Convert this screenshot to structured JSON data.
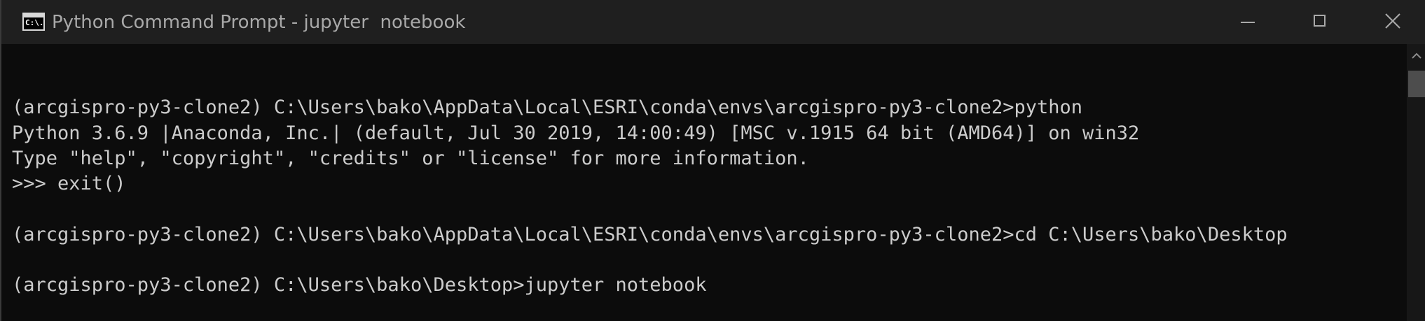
{
  "window": {
    "title": "Python Command Prompt - jupyter  notebook",
    "app_icon_text": "C:\\."
  },
  "console": {
    "lines": [
      "",
      "(arcgispro-py3-clone2) C:\\Users\\bako\\AppData\\Local\\ESRI\\conda\\envs\\arcgispro-py3-clone2>python",
      "Python 3.6.9 |Anaconda, Inc.| (default, Jul 30 2019, 14:00:49) [MSC v.1915 64 bit (AMD64)] on win32",
      "Type \"help\", \"copyright\", \"credits\" or \"license\" for more information.",
      ">>> exit()",
      "",
      "(arcgispro-py3-clone2) C:\\Users\\bako\\AppData\\Local\\ESRI\\conda\\envs\\arcgispro-py3-clone2>cd C:\\Users\\bako\\Desktop",
      "",
      "(arcgispro-py3-clone2) C:\\Users\\bako\\Desktop>jupyter notebook"
    ]
  },
  "icons": {
    "app": "command-prompt-icon",
    "minimize": "minimize-icon",
    "maximize": "maximize-icon",
    "close": "close-icon",
    "scroll_up": "chevron-up-icon"
  },
  "colors": {
    "console_bg": "#0c0c0c",
    "console_text": "#cccccc",
    "titlebar_bg": "#1f1f1f",
    "title_text": "#a9a9a9"
  }
}
